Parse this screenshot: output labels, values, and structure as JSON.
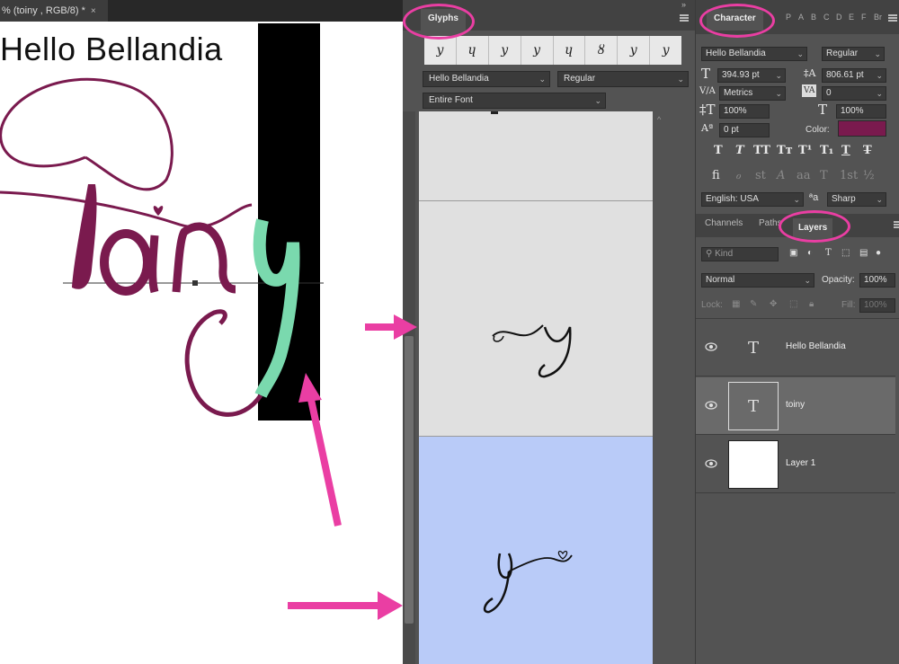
{
  "document": {
    "tab_title": "% (toiny , RGB/8) *",
    "close_glyph": "×",
    "canvas_text": "Hello Bellandia"
  },
  "glyphs_panel": {
    "tab_label": "Glyphs",
    "recent_glyphs": [
      "y",
      "ɥ",
      "y",
      "y",
      "ɥ",
      "ȣ",
      "y",
      "y"
    ],
    "font_family": "Hello Bellandia",
    "font_style": "Regular",
    "filter": "Entire Font",
    "chevron": "⌄"
  },
  "character_panel": {
    "tab_label": "Character",
    "extra_tabs": [
      "P",
      "A",
      "B",
      "C",
      "D",
      "E",
      "F",
      "G",
      "Br"
    ],
    "font_family": "Hello Bellandia",
    "font_style": "Regular",
    "font_size": "394.93 pt",
    "leading": "806.61 pt",
    "kerning": "Metrics",
    "tracking": "0",
    "vertical_scale": "100%",
    "horizontal_scale": "100%",
    "baseline_shift": "0 pt",
    "color_label": "Color:",
    "color": "#7a1a4e",
    "style_buttons": [
      "T",
      "T",
      "TT",
      "Tт",
      "T¹",
      "T₁",
      "T",
      "T̶"
    ],
    "opentype_buttons": [
      "fi",
      "ℴ",
      "st",
      "A",
      "aa",
      "T",
      "1st",
      "½"
    ],
    "language": "English: USA",
    "aa_icon": "ªa",
    "antialias": "Sharp"
  },
  "layers_panel": {
    "tabs": [
      "Channels",
      "Paths",
      "Layers"
    ],
    "kind_placeholder": "Kind",
    "blend_mode": "Normal",
    "opacity_label": "Opacity:",
    "opacity": "100%",
    "lock_label": "Lock:",
    "fill_label": "Fill:",
    "fill": "100%",
    "layers": [
      {
        "name": "Hello Bellandia",
        "thumb": "T",
        "selected": false
      },
      {
        "name": "toiny",
        "thumb": "T",
        "selected": true
      },
      {
        "name": "Layer 1",
        "thumb": "",
        "selected": false
      }
    ]
  },
  "annotation_color": "#ea3ea3",
  "theme": {
    "panel_bg": "#535353",
    "glyph_highlight": "#b9cbf8"
  }
}
